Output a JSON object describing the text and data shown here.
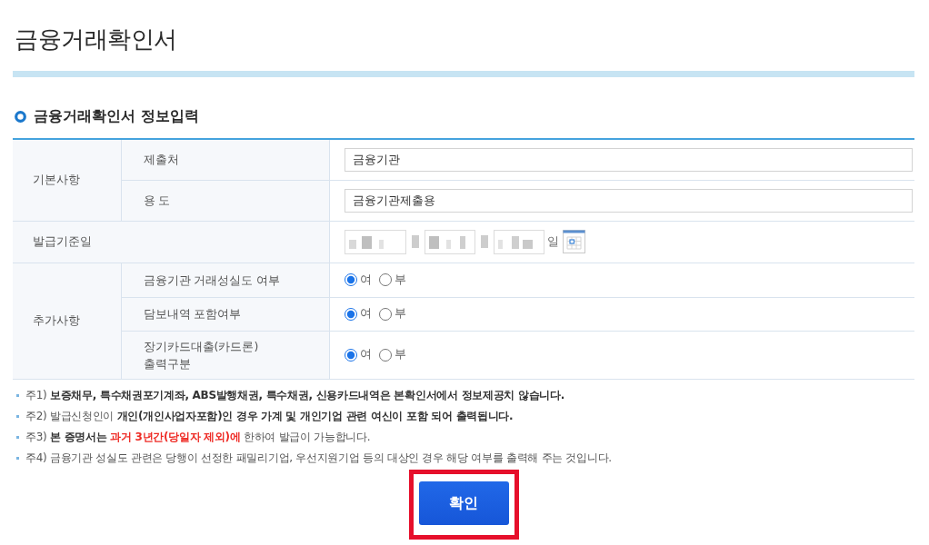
{
  "page_title": "금융거래확인서",
  "section_title": "금융거래확인서 정보입력",
  "form_rows": [
    {
      "kind": "group",
      "label": "기본사항",
      "fields": [
        {
          "label": "제출처",
          "kind": "text",
          "value": "금융기관"
        },
        {
          "label": "용 도",
          "kind": "text",
          "value": "금융기관제출용"
        }
      ]
    },
    {
      "kind": "single",
      "label": "발급기준일",
      "field": {
        "kind": "date",
        "parts": [
          {
            "redacted": true
          },
          {
            "redacted": true
          },
          {
            "redacted": true
          }
        ],
        "suffix": "일"
      }
    },
    {
      "kind": "group",
      "label": "추가사항",
      "fields": [
        {
          "label": "금융기관 거래성실도 여부",
          "kind": "radio",
          "options": [
            {
              "label": "여",
              "selected": true
            },
            {
              "label": "부",
              "selected": false
            }
          ]
        },
        {
          "label": "담보내역 포함여부",
          "kind": "radio",
          "options": [
            {
              "label": "여",
              "selected": true
            },
            {
              "label": "부",
              "selected": false
            }
          ]
        },
        {
          "label": "장기카드대출(카드론)\n출력구분",
          "kind": "radio",
          "options": [
            {
              "label": "여",
              "selected": true
            },
            {
              "label": "부",
              "selected": false
            }
          ]
        }
      ]
    }
  ],
  "notes": [
    {
      "parts": [
        {
          "kind": "plain",
          "text": "주1) "
        },
        {
          "kind": "bold",
          "text": "보증채무, 특수채권포기계좌, ABS발행채권, 특수채권, 신용카드내역은 본확인서에서 정보제공치 않습니다."
        }
      ]
    },
    {
      "parts": [
        {
          "kind": "plain",
          "text": "주2) 발급신청인이 "
        },
        {
          "kind": "bold",
          "text": "개인(개인사업자포함)인 경우 가계 및 개인기업 관련 여신이 포함 되어 출력됩니다."
        }
      ]
    },
    {
      "parts": [
        {
          "kind": "plain",
          "text": "주3) "
        },
        {
          "kind": "bold",
          "text": "본 증명서는 "
        },
        {
          "kind": "alert",
          "text": "과거 3년간(당일자 제외)에"
        },
        {
          "kind": "plain",
          "text": " 한하여 발급이 가능합니다."
        }
      ]
    },
    {
      "parts": [
        {
          "kind": "plain",
          "text": "주4) 금융기관 성실도 관련은 당행이 선정한 패밀리기업, 우선지원기업 등의 대상인 경우 해당 여부를 출력해 주는 것입니다."
        }
      ]
    }
  ],
  "confirm_button": {
    "label": "확인",
    "highlighted": true
  }
}
